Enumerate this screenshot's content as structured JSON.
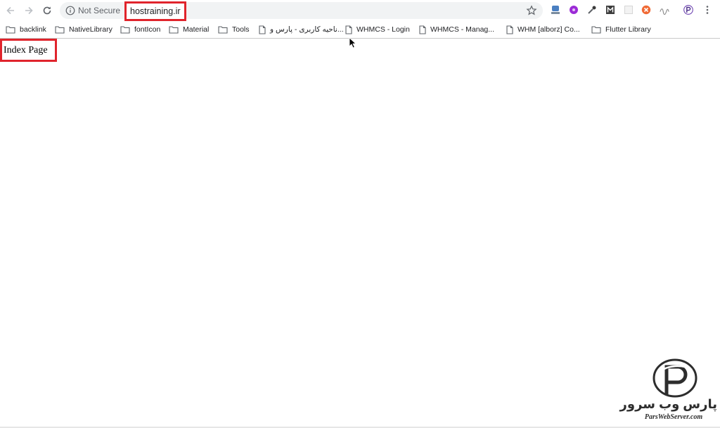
{
  "toolbar": {
    "security_label": "Not Secure",
    "url": "hostraining.ir"
  },
  "bookmarks": [
    {
      "type": "folder",
      "label": "backlink"
    },
    {
      "type": "folder",
      "label": "NativeLibrary"
    },
    {
      "type": "folder",
      "label": "fontIcon"
    },
    {
      "type": "folder",
      "label": "Material"
    },
    {
      "type": "folder",
      "label": "Tools"
    },
    {
      "type": "page",
      "label": "ناحیه کاربری - پارس و..."
    },
    {
      "type": "page",
      "label": "WHMCS - Login"
    },
    {
      "type": "page",
      "label": "WHMCS - Manag..."
    },
    {
      "type": "page",
      "label": "WHM [alborz] Co..."
    },
    {
      "type": "folder",
      "label": "Flutter Library"
    }
  ],
  "page": {
    "heading": "Index Page"
  },
  "watermark": {
    "brand": "پارس وب سرور",
    "url": "ParsWebServer.com"
  },
  "colors": {
    "highlight": "#e0242c",
    "omnibox_bg": "#f1f3f4",
    "icon_gray": "#5f6368"
  }
}
